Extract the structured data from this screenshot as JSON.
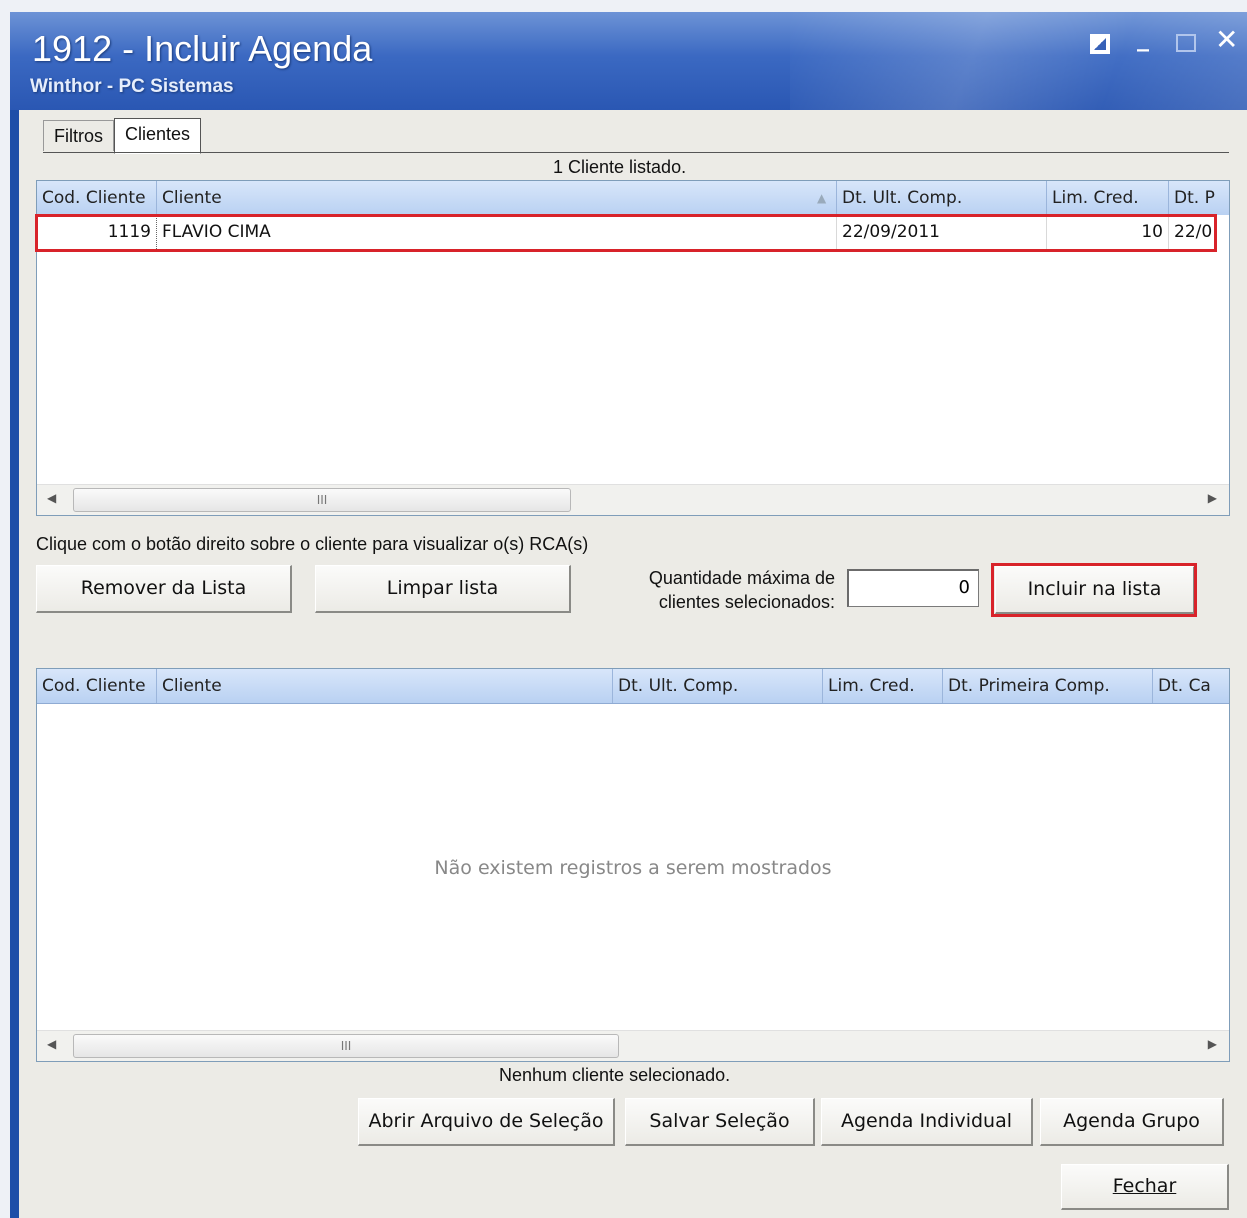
{
  "window": {
    "title": "1912 - Incluir Agenda",
    "subtitle": "Winthor - PC Sistemas"
  },
  "tabs": [
    {
      "label": "Filtros",
      "active": false
    },
    {
      "label": "Clientes",
      "active": true
    }
  ],
  "top_grid": {
    "status": "1 Cliente listado.",
    "columns": [
      "Cod. Cliente",
      "Cliente",
      "Dt. Ult. Comp.",
      "Lim. Cred.",
      "Dt. P"
    ],
    "rows": [
      {
        "cod": "1119",
        "cliente": "FLAVIO CIMA",
        "dt_ult_comp": "22/09/2011",
        "lim_cred": "10",
        "dt_p": "22/0"
      }
    ]
  },
  "hint": "Clique com o botão direito sobre o cliente para visualizar o(s) RCA(s)",
  "actions": {
    "remover": "Remover da Lista",
    "limpar": "Limpar lista",
    "qtd_label_1": "Quantidade máxima de",
    "qtd_label_2": "clientes selecionados:",
    "qtd_value": "0",
    "incluir": "Incluir na lista"
  },
  "bottom_grid": {
    "columns": [
      "Cod. Cliente",
      "Cliente",
      "Dt. Ult. Comp.",
      "Lim. Cred.",
      "Dt. Primeira Comp.",
      "Dt. Ca"
    ],
    "empty_message": "Não existem registros a serem mostrados",
    "status": "Nenhum cliente selecionado."
  },
  "footer": {
    "abrir": "Abrir Arquivo de Seleção",
    "salvar": "Salvar Seleção",
    "agenda_individual": "Agenda Individual",
    "agenda_grupo": "Agenda Grupo",
    "fechar": "Fechar"
  },
  "scroll_thumb_glyph": "III",
  "highlight_color": "#d8232a"
}
